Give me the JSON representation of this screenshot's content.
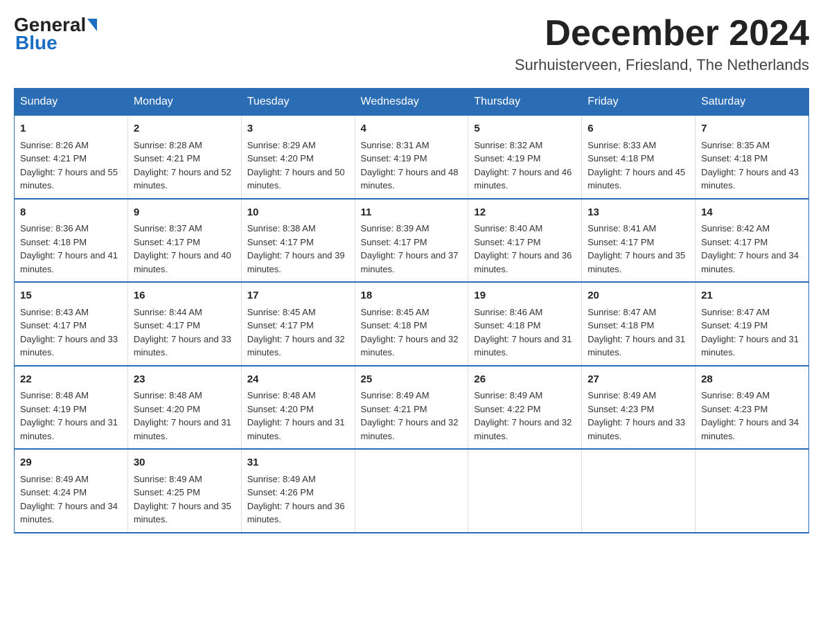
{
  "header": {
    "logo_general": "General",
    "logo_blue": "Blue",
    "month_title": "December 2024",
    "location": "Surhuisterveen, Friesland, The Netherlands"
  },
  "days_of_week": [
    "Sunday",
    "Monday",
    "Tuesday",
    "Wednesday",
    "Thursday",
    "Friday",
    "Saturday"
  ],
  "weeks": [
    [
      {
        "day": "1",
        "sunrise": "8:26 AM",
        "sunset": "4:21 PM",
        "daylight": "7 hours and 55 minutes."
      },
      {
        "day": "2",
        "sunrise": "8:28 AM",
        "sunset": "4:21 PM",
        "daylight": "7 hours and 52 minutes."
      },
      {
        "day": "3",
        "sunrise": "8:29 AM",
        "sunset": "4:20 PM",
        "daylight": "7 hours and 50 minutes."
      },
      {
        "day": "4",
        "sunrise": "8:31 AM",
        "sunset": "4:19 PM",
        "daylight": "7 hours and 48 minutes."
      },
      {
        "day": "5",
        "sunrise": "8:32 AM",
        "sunset": "4:19 PM",
        "daylight": "7 hours and 46 minutes."
      },
      {
        "day": "6",
        "sunrise": "8:33 AM",
        "sunset": "4:18 PM",
        "daylight": "7 hours and 45 minutes."
      },
      {
        "day": "7",
        "sunrise": "8:35 AM",
        "sunset": "4:18 PM",
        "daylight": "7 hours and 43 minutes."
      }
    ],
    [
      {
        "day": "8",
        "sunrise": "8:36 AM",
        "sunset": "4:18 PM",
        "daylight": "7 hours and 41 minutes."
      },
      {
        "day": "9",
        "sunrise": "8:37 AM",
        "sunset": "4:17 PM",
        "daylight": "7 hours and 40 minutes."
      },
      {
        "day": "10",
        "sunrise": "8:38 AM",
        "sunset": "4:17 PM",
        "daylight": "7 hours and 39 minutes."
      },
      {
        "day": "11",
        "sunrise": "8:39 AM",
        "sunset": "4:17 PM",
        "daylight": "7 hours and 37 minutes."
      },
      {
        "day": "12",
        "sunrise": "8:40 AM",
        "sunset": "4:17 PM",
        "daylight": "7 hours and 36 minutes."
      },
      {
        "day": "13",
        "sunrise": "8:41 AM",
        "sunset": "4:17 PM",
        "daylight": "7 hours and 35 minutes."
      },
      {
        "day": "14",
        "sunrise": "8:42 AM",
        "sunset": "4:17 PM",
        "daylight": "7 hours and 34 minutes."
      }
    ],
    [
      {
        "day": "15",
        "sunrise": "8:43 AM",
        "sunset": "4:17 PM",
        "daylight": "7 hours and 33 minutes."
      },
      {
        "day": "16",
        "sunrise": "8:44 AM",
        "sunset": "4:17 PM",
        "daylight": "7 hours and 33 minutes."
      },
      {
        "day": "17",
        "sunrise": "8:45 AM",
        "sunset": "4:17 PM",
        "daylight": "7 hours and 32 minutes."
      },
      {
        "day": "18",
        "sunrise": "8:45 AM",
        "sunset": "4:18 PM",
        "daylight": "7 hours and 32 minutes."
      },
      {
        "day": "19",
        "sunrise": "8:46 AM",
        "sunset": "4:18 PM",
        "daylight": "7 hours and 31 minutes."
      },
      {
        "day": "20",
        "sunrise": "8:47 AM",
        "sunset": "4:18 PM",
        "daylight": "7 hours and 31 minutes."
      },
      {
        "day": "21",
        "sunrise": "8:47 AM",
        "sunset": "4:19 PM",
        "daylight": "7 hours and 31 minutes."
      }
    ],
    [
      {
        "day": "22",
        "sunrise": "8:48 AM",
        "sunset": "4:19 PM",
        "daylight": "7 hours and 31 minutes."
      },
      {
        "day": "23",
        "sunrise": "8:48 AM",
        "sunset": "4:20 PM",
        "daylight": "7 hours and 31 minutes."
      },
      {
        "day": "24",
        "sunrise": "8:48 AM",
        "sunset": "4:20 PM",
        "daylight": "7 hours and 31 minutes."
      },
      {
        "day": "25",
        "sunrise": "8:49 AM",
        "sunset": "4:21 PM",
        "daylight": "7 hours and 32 minutes."
      },
      {
        "day": "26",
        "sunrise": "8:49 AM",
        "sunset": "4:22 PM",
        "daylight": "7 hours and 32 minutes."
      },
      {
        "day": "27",
        "sunrise": "8:49 AM",
        "sunset": "4:23 PM",
        "daylight": "7 hours and 33 minutes."
      },
      {
        "day": "28",
        "sunrise": "8:49 AM",
        "sunset": "4:23 PM",
        "daylight": "7 hours and 34 minutes."
      }
    ],
    [
      {
        "day": "29",
        "sunrise": "8:49 AM",
        "sunset": "4:24 PM",
        "daylight": "7 hours and 34 minutes."
      },
      {
        "day": "30",
        "sunrise": "8:49 AM",
        "sunset": "4:25 PM",
        "daylight": "7 hours and 35 minutes."
      },
      {
        "day": "31",
        "sunrise": "8:49 AM",
        "sunset": "4:26 PM",
        "daylight": "7 hours and 36 minutes."
      },
      null,
      null,
      null,
      null
    ]
  ],
  "labels": {
    "sunrise_prefix": "Sunrise: ",
    "sunset_prefix": "Sunset: ",
    "daylight_prefix": "Daylight: "
  }
}
